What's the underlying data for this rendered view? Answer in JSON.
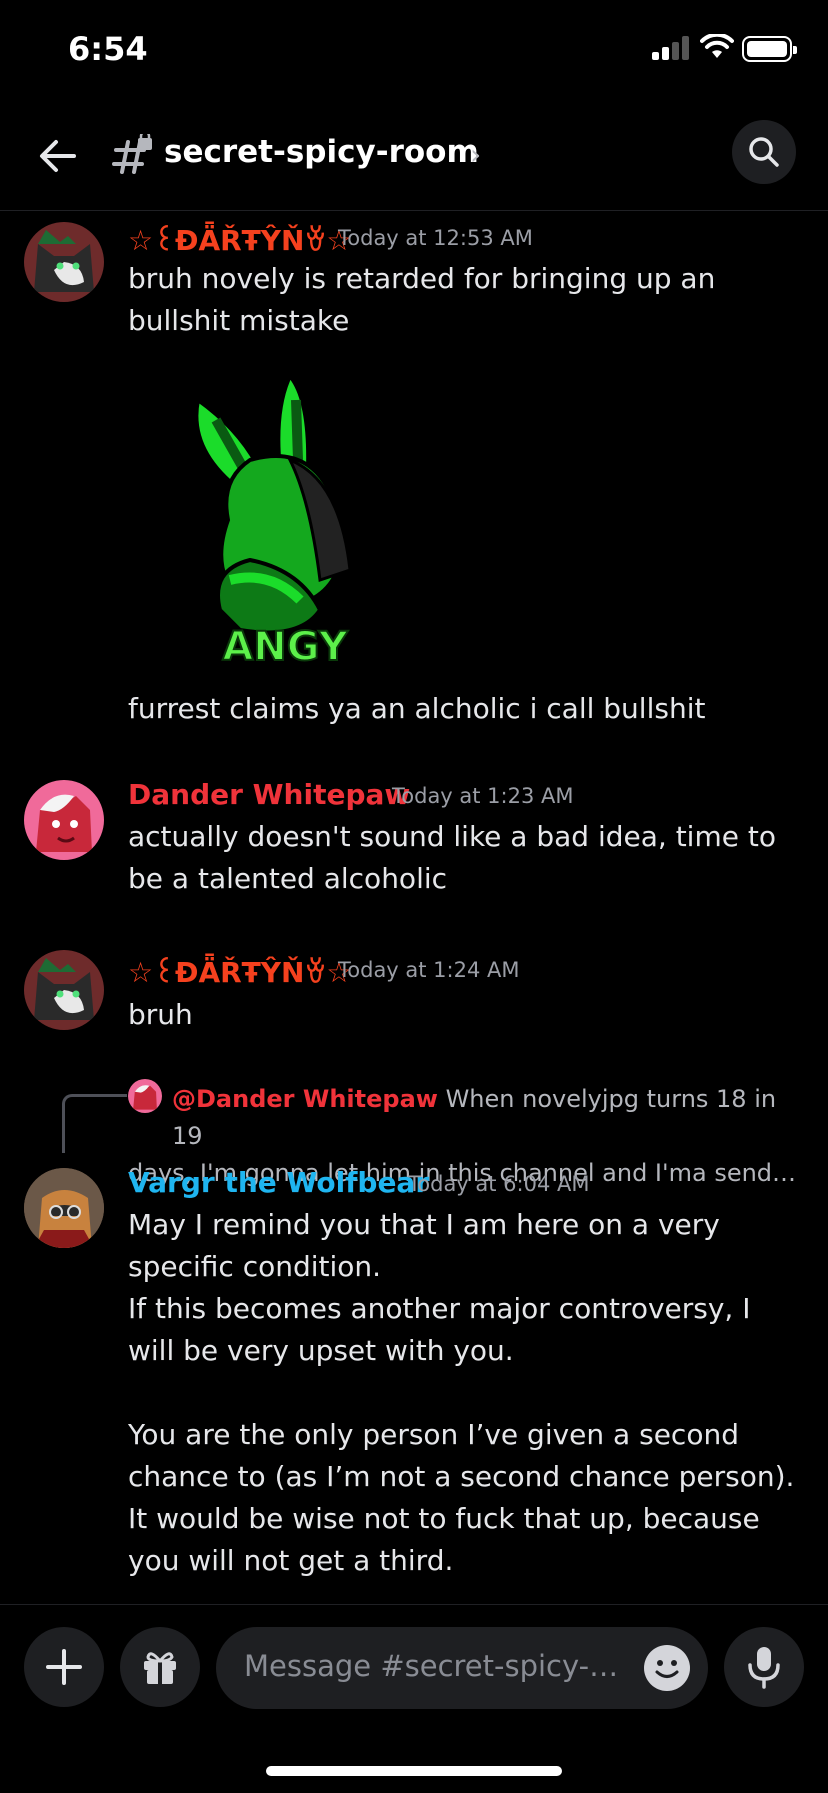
{
  "status_bar": {
    "time": "6:54"
  },
  "header": {
    "channel_name": "secret-spicy-room",
    "chevron": "›"
  },
  "messages": [
    {
      "author": "☆꒰ĐǞŘŦŶŇꈊ☆",
      "author_color": "#f5411e",
      "timestamp": "Today at 12:53 AM",
      "text": "bruh novely is retarded for bringing up an bullshit mistake",
      "sticker_label": "ANGY",
      "text2": "furrest claims ya an alcholic i call bullshit"
    },
    {
      "author": "Dander Whitepaw",
      "author_color": "#f0333a",
      "timestamp": "Today at 1:23 AM",
      "text": "actually doesn't sound like a bad idea, time to be a talented alcoholic"
    },
    {
      "author": "☆꒰ĐǞŘŦŶŇꈊ☆",
      "author_color": "#f5411e",
      "timestamp": "Today at 1:24 AM",
      "text": "bruh"
    },
    {
      "reply_to": {
        "name": "@Dander Whitepaw",
        "text_line1": "When novelyjpg turns 18 in 19",
        "text_line2": "days, I'm gonna let him in this channel and I'ma send u your own bottle"
      },
      "author": "Vargr the Wolfbear",
      "author_color": "#1fb5f0",
      "timestamp": "Today at 6:04 AM",
      "para1": "May I remind you that I am here on a very specific condition.",
      "para2": "If this becomes another major controversy, I will be very upset with you.",
      "para3": "You are the only person I’ve given a second chance to (as I’m not a second chance person). It would be wise not to fuck that up, because you will not get a third."
    }
  ],
  "composer": {
    "placeholder": "Message #secret-spicy-room"
  }
}
